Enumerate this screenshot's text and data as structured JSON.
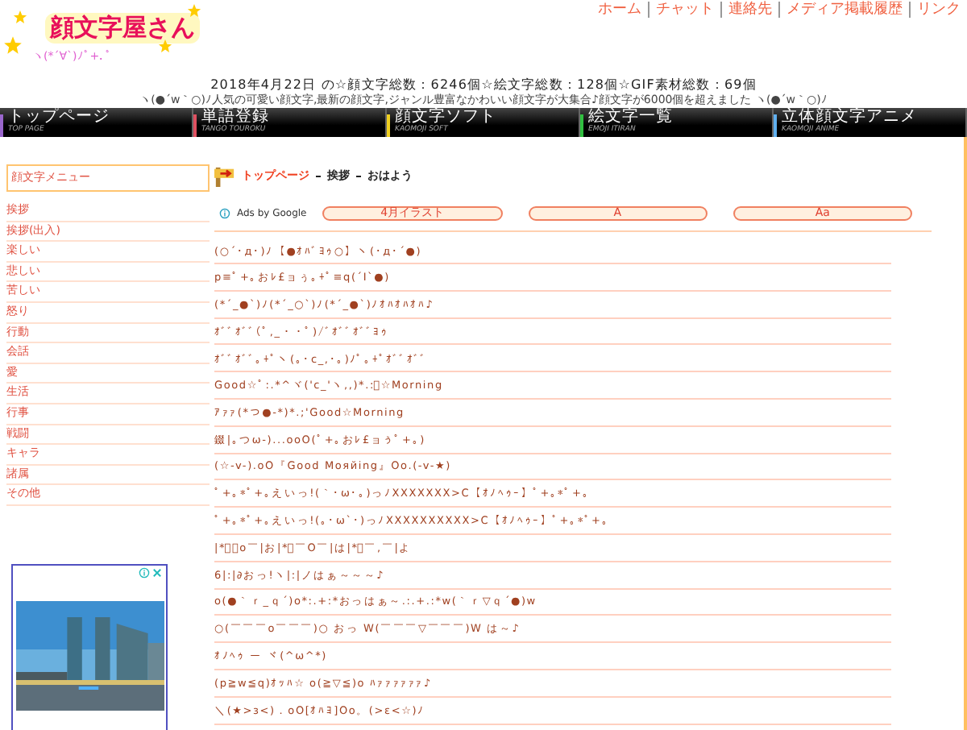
{
  "top_links": [
    "ホーム",
    "チャット",
    "連絡先",
    "メディア掲載履歴",
    "リンク"
  ],
  "logo": {
    "title": "顔文字屋さん",
    "subtitle": "ヽ(*´∀`)ﾉﾟ+.ﾟ"
  },
  "date_line": "2018年4月22日 の☆顔文字総数：6246個☆絵文字総数：128個☆GIF素材総数：69個",
  "marquee": "ヽ(●´w｀○)ﾉ人気の可愛い顔文字,最新の顔文字,ジャンル豊富なかわいい顔文字が大集合♪顔文字が6000個を超えました ヽ(●´w｀○)ﾉ",
  "nav": [
    {
      "label": "トップページ",
      "sub": "TOP PAGE",
      "color": "#9966cc"
    },
    {
      "label": "単語登録",
      "sub": "TANGO TOUROKU",
      "color": "#e05060"
    },
    {
      "label": "顔文字ソフト",
      "sub": "KAOMOJI SOFT",
      "color": "#f0d020"
    },
    {
      "label": "絵文字一覧",
      "sub": "EMOJI ITIRAN",
      "color": "#30c040"
    },
    {
      "label": "立体顔文字アニメ",
      "sub": "KAOMOJI ANIME",
      "color": "#60b0f0"
    }
  ],
  "sidebar": {
    "title": "顔文字メニュー",
    "items": [
      "挨拶",
      "挨拶(出入)",
      "楽しい",
      "悲しい",
      "苦しい",
      "怒り",
      "行動",
      "会話",
      "愛",
      "生活",
      "行事",
      "戦闘",
      "キャラ",
      "諸属",
      "その他"
    ]
  },
  "breadcrumb": [
    "トップページ",
    "挨拶",
    "おはよう"
  ],
  "ads_label": "Ads by Google",
  "ad_links": [
    "4月イラスト",
    "A",
    "Aa"
  ],
  "kaomoji": [
    "(○´･д･)ﾉ【●ｵﾊﾞﾖｩ○】ヽ(･д･´●)",
    "p≡ﾟ+｡おﾚ£ョぅ｡+ﾟ≡q(´I`●)",
    "(*´_●`)ﾉ(*´_○`)ﾉ(*´_●`)ﾉｵﾊｵﾊｵﾊ♪",
    "ｵﾞﾞｵﾞﾞ(ﾟ,_・・ﾟ)/ﾞｵﾞﾞｵﾞﾞﾖｩ",
    "ｵﾞﾞｵﾞﾞ｡+ﾟヽ(｡･c_,･｡)ﾉﾟ｡+ﾟｵﾞﾞｵﾞﾞ",
    "Good☆ﾟ:.*^ヾ('c_'ヽ,,)*.:ﾟ☆Morning",
    "ｱｧｧ(*つ●-*)*.;'Good☆Morning",
    "錣|｡つω-)...ooO(ﾟ+｡おﾚ£ョぅﾟ+｡)",
    "(☆-v-).oO『Good Moяйing』Oo.(-v-★)",
    "ﾟ+｡*ﾟ+｡えいっ!(｀･ω･｡)っﾉXXXXXXX>C【ｵﾉﾍｩｰ】ﾟ+｡*ﾟ+｡",
    "ﾟ+｡*ﾟ+｡えいっ!(｡･ω`･)っﾉXXXXXXXXXX>C【ｵﾉﾍｩｰ】ﾟ+｡*ﾟ+｡",
    "|*ﾟ￣o￣|お|*ﾟ￣O￣|は|*ﾟ￣,￣|よ",
    "6|:|∂おっ!ヽ|:|ノはぁ～～～♪",
    "o(●｀ｒ_ｑ´)o*:.+:*おっはぁ～.:.+.:*w(｀ｒ▽ｑ´●)w",
    "○(￣￣￣o￣￣￣)○ おっ W(￣￣￣▽￣￣￣)W は～♪",
    "ｵﾉﾍｩ ー ヾ(^ω^*)",
    "(p≧w≦q)ｵｯﾊ☆ o(≧▽≦)o ﾊｧｧｧｧｧｧ♪",
    "＼(★>з<)．oO[ｵﾊﾖ]Oo。(>ε<☆)ﾉ"
  ]
}
